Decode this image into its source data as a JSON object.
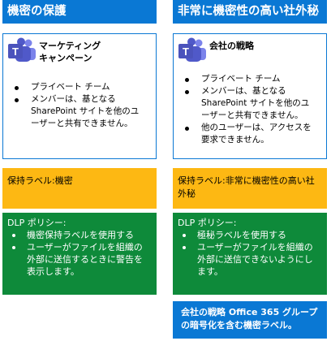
{
  "left": {
    "header": "機密の保護",
    "team_name": "マーケティング\nキャンペーン",
    "bullets": [
      "プライベート チーム",
      "メンバーは、基となる SharePoint サイトを他のユーザーと共有できません。"
    ],
    "label": "保持ラベル:機密",
    "dlp_title": "DLP ポリシー:",
    "dlp_bullets": [
      "機密保持ラベルを使用する",
      "ユーザーがファイルを組織の外部に送信するときに警告を表示します。"
    ]
  },
  "right": {
    "header": "非常に機密性の高い社外秘",
    "team_name": "会社の戦略",
    "bullets": [
      "プライベート チーム",
      "メンバーは、基となる SharePoint サイトを他のユーザーと共有できません。",
      "他のユーザーは、アクセスを要求できません。"
    ],
    "label": "保持ラベル:非常に機密性の高い社外秘",
    "dlp_title": "DLP ポリシー:",
    "dlp_bullets": [
      "極秘ラベルを使用する",
      "ユーザーがファイルを組織の外部に送信できないようにします。"
    ],
    "encryption": "会社の戦略 Office 365 グループの暗号化を含む機密ラベル。"
  },
  "icons": {
    "team": "microsoft-teams-icon"
  },
  "colors": {
    "blue": "#0a78d4",
    "yellow": "#fdb813",
    "green": "#0e8a3a"
  }
}
